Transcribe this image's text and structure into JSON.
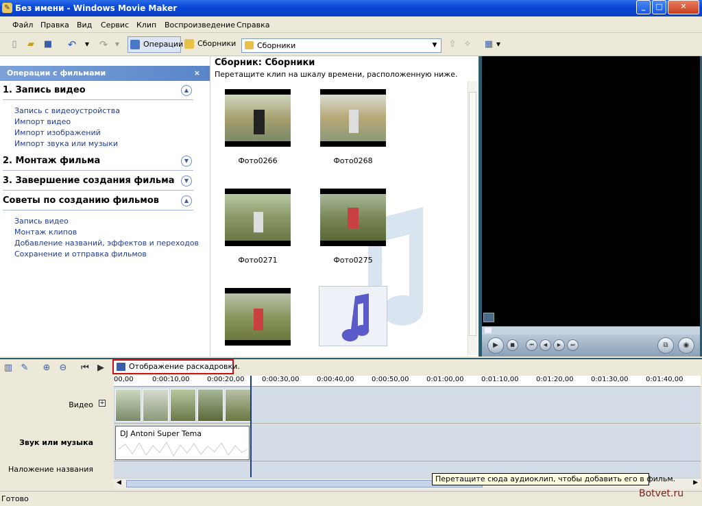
{
  "window": {
    "title": "Без имени - Windows Movie Maker"
  },
  "menu": [
    "Файл",
    "Правка",
    "Вид",
    "Сервис",
    "Клип",
    "Воспроизведение",
    "Справка"
  ],
  "toolbar": {
    "operations": "Операции",
    "collections": "Сборники",
    "combo_value": "Сборники"
  },
  "tasks": {
    "header": "Операции с фильмами",
    "sections": [
      {
        "title": "1. Запись видео",
        "links": [
          "Запись с видеоустройства",
          "Импорт видео",
          "Импорт изображений",
          "Импорт звука или музыки"
        ]
      },
      {
        "title": "2. Монтаж фильма",
        "links": []
      },
      {
        "title": "3. Завершение создания фильма",
        "links": []
      },
      {
        "title": "Советы по созданию фильмов",
        "links": [
          "Запись видео",
          "Монтаж клипов",
          "Добавление названий, эффектов и переходов",
          "Сохранение и отправка фильмов"
        ]
      }
    ]
  },
  "collection": {
    "title": "Сборник: Сборники",
    "hint": "Перетащите клип на шкалу времени, расположенную ниже.",
    "clips": [
      "Фото0266",
      "Фото0268",
      "Фото0271",
      "Фото0275"
    ]
  },
  "timeline": {
    "storyboard_button": "Отображение раскадровки.",
    "ruler": [
      "00,00",
      "0:00:10,00",
      "0:00:20,00",
      "0:00:30,00",
      "0:00:40,00",
      "0:00:50,00",
      "0:01:00,00",
      "0:01:10,00",
      "0:01:20,00",
      "0:01:30,00",
      "0:01:40,00"
    ],
    "tracks": {
      "video": "Видео",
      "audio": "Звук или музыка",
      "title": "Наложение названия"
    },
    "audio_clip": "DJ Antoni Super Tema"
  },
  "tooltip": "Перетащите сюда аудиоклип, чтобы добавить его в фильм.",
  "status": "Готово",
  "watermark": "Botvet.ru",
  "colors": {
    "accent": "#0a46d6",
    "highlight": "#cc1010"
  }
}
